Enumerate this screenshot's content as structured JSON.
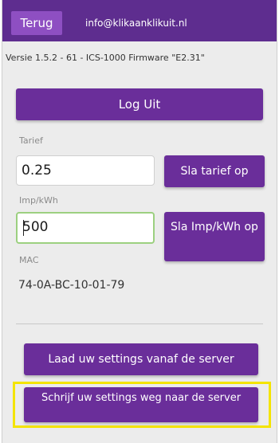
{
  "header": {
    "back_label": "Terug",
    "email": "info@klikaanklikuit.nl"
  },
  "version_text": "Versie 1.5.2 - 61 - ICS-1000 Firmware \"E2.31\"",
  "logout_label": "Log Uit",
  "tarief": {
    "label": "Tarief",
    "value": "0.25",
    "save_label": "Sla tarief op"
  },
  "imp": {
    "label": "Imp/kWh",
    "value": "500",
    "save_label": "Sla Imp/kWh op"
  },
  "mac": {
    "label": "MAC",
    "value": "74-0A-BC-10-01-79"
  },
  "server": {
    "load_label": "Laad uw settings vanaf de server",
    "write_label": "Schrijf uw settings weg naar de server"
  },
  "colors": {
    "header_bg": "#5e2d8f",
    "button_bg": "#6a2e9a",
    "highlight": "#f4e400"
  }
}
